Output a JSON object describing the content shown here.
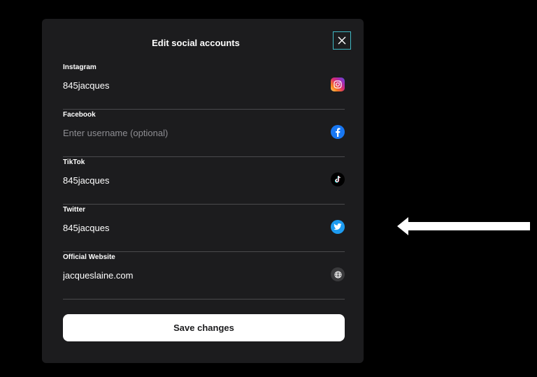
{
  "modal": {
    "title": "Edit social accounts",
    "close_icon": "close-icon",
    "save_label": "Save changes"
  },
  "fields": [
    {
      "label": "Instagram",
      "value": "845jacques",
      "placeholder": "",
      "icon": "instagram-icon",
      "icon_color": "#dc2743"
    },
    {
      "label": "Facebook",
      "value": "",
      "placeholder": "Enter username (optional)",
      "icon": "facebook-icon",
      "icon_color": "#1877f2"
    },
    {
      "label": "TikTok",
      "value": "845jacques",
      "placeholder": "",
      "icon": "tiktok-icon",
      "icon_color": "#000000"
    },
    {
      "label": "Twitter",
      "value": "845jacques",
      "placeholder": "",
      "icon": "twitter-icon",
      "icon_color": "#1d9bf0"
    },
    {
      "label": "Official Website",
      "value": "jacqueslaine.com",
      "placeholder": "",
      "icon": "globe-icon",
      "icon_color": "#3a3a3c"
    }
  ],
  "colors": {
    "modal_bg": "#1c1c1e",
    "accent_close_border": "#3fb8c4",
    "save_button_bg": "#ffffff",
    "arrow": "#ffffff"
  }
}
